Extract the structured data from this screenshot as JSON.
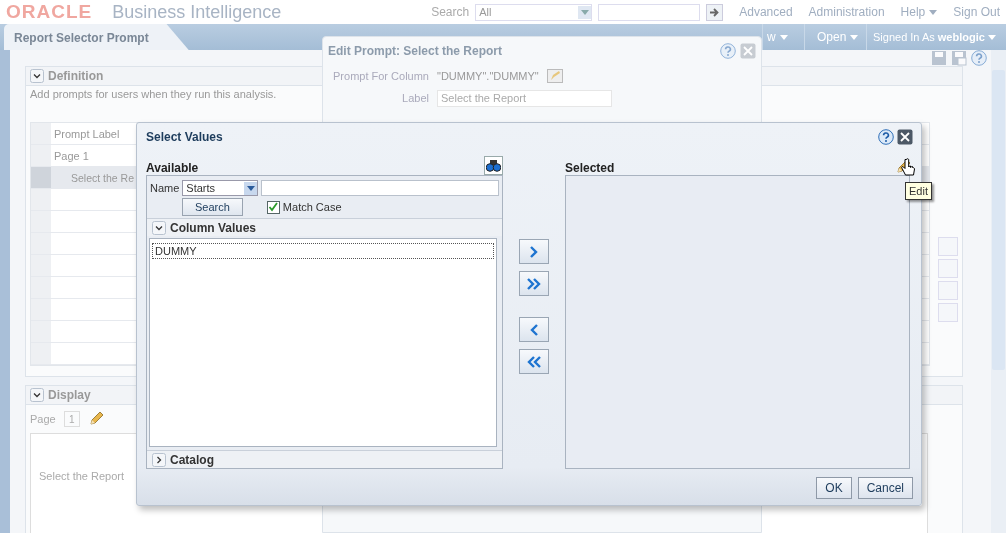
{
  "header": {
    "logo": "ORACLE",
    "product": "Business Intelligence",
    "search_label": "Search",
    "search_scope": "All",
    "links": [
      {
        "label": "Advanced",
        "menu": false
      },
      {
        "label": "Administration",
        "menu": false
      },
      {
        "label": "Help",
        "menu": true
      },
      {
        "label": "Sign Out",
        "menu": false
      }
    ]
  },
  "tabbar": {
    "tab": "Report Selector Prompt",
    "menus": [
      {
        "label": "w",
        "menu": true
      },
      {
        "label": "Open",
        "menu": true
      }
    ],
    "signed_in_label": "Signed In As",
    "user": "weblogic"
  },
  "definition": {
    "title": "Definition",
    "expanded": true,
    "hint": "Add prompts for users when they run this analysis.",
    "columns": [
      "Prompt Label"
    ],
    "rows": [
      {
        "label": "Page 1",
        "selected": false
      },
      {
        "label": "Select the Re",
        "selected": true
      }
    ]
  },
  "display": {
    "title": "Display",
    "expanded": true,
    "page_label": "Page",
    "page_value": "1",
    "preview_label": "Select the Report"
  },
  "edit_prompt": {
    "title": "Edit Prompt: Select the Report",
    "fields": [
      {
        "label": "Prompt For Column",
        "value": "\"DUMMY\".\"DUMMY\"",
        "kind": "text"
      },
      {
        "label": "Label",
        "value": "Select the Report",
        "kind": "input"
      }
    ]
  },
  "select_values": {
    "title": "Select Values",
    "available": {
      "title": "Available",
      "name_label": "Name",
      "operator": "Starts",
      "search_button": "Search",
      "match_case": {
        "label": "Match Case",
        "checked": true
      },
      "sections": [
        {
          "title": "Column Values",
          "expanded": true,
          "items": [
            "DUMMY"
          ]
        },
        {
          "title": "Catalog",
          "expanded": false
        }
      ]
    },
    "selected": {
      "title": "Selected",
      "tooltip": "Edit"
    },
    "buttons": [
      "OK",
      "Cancel"
    ]
  }
}
